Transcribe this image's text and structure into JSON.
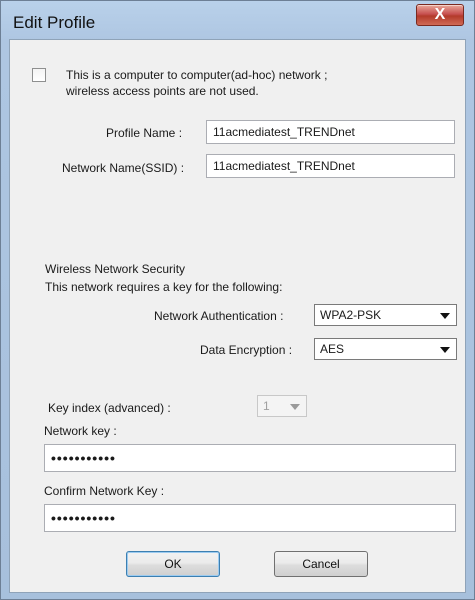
{
  "window": {
    "title": "Edit Profile",
    "close_symbol": "X"
  },
  "adhoc": {
    "checked": false,
    "line1": "This is a computer to computer(ad-hoc) network ;",
    "line2": "wireless access points are not used."
  },
  "profile": {
    "profile_name_label": "Profile Name :",
    "profile_name_value": "11acmediatest_TRENDnet",
    "ssid_label": "Network Name(SSID) :",
    "ssid_value": "11acmediatest_TRENDnet"
  },
  "security": {
    "heading": "Wireless Network Security",
    "subheading": "This network requires a key for the following:",
    "auth_label": "Network Authentication :",
    "auth_value": "WPA2-PSK",
    "enc_label": "Data Encryption :",
    "enc_value": "AES"
  },
  "keys": {
    "key_index_label": "Key index (advanced) :",
    "key_index_value": "1",
    "network_key_label": "Network key :",
    "network_key_value": "•••••••••••",
    "confirm_key_label": "Confirm Network Key :",
    "confirm_key_value": "•••••••••••"
  },
  "buttons": {
    "ok": "OK",
    "cancel": "Cancel"
  },
  "icons": {
    "close": "close-icon",
    "dropdown": "chevron-down-icon"
  }
}
